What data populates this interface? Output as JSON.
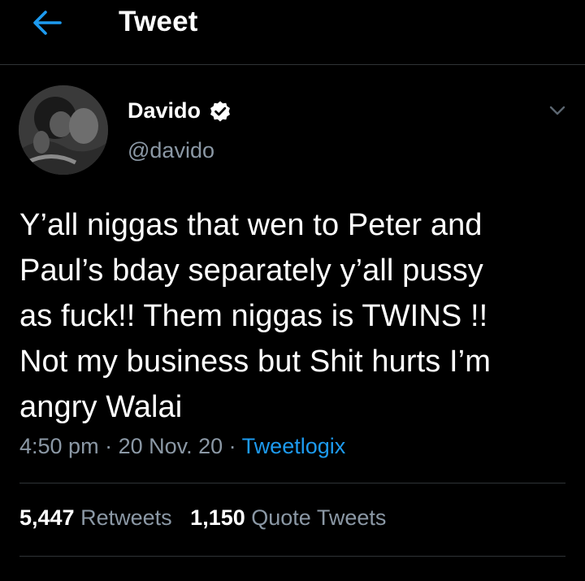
{
  "header": {
    "title": "Tweet",
    "back_icon": "arrow-left-icon",
    "accent_color": "#1d9bf0"
  },
  "tweet": {
    "author": {
      "display_name": "Davido",
      "handle": "@davido",
      "verified": true,
      "verified_icon": "verified-badge-icon"
    },
    "menu_icon": "chevron-down-icon",
    "text": "Y’all niggas that wen to Peter and\nPaul’s bday separately y’all pussy\nas fuck!! Them niggas  is TWINS !!\nNot my business but Shit hurts I’m\nangry Walai",
    "time": "4:50 pm",
    "date": "20 Nov. 20",
    "source": "Tweetlogix",
    "separator": " · "
  },
  "stats": {
    "retweets_count": "5,447",
    "retweets_label": "Retweets",
    "quote_tweets_count": "1,150",
    "quote_tweets_label": "Quote Tweets"
  },
  "colors": {
    "background": "#000000",
    "text_primary": "#ffffff",
    "text_secondary": "#8b98a5",
    "divider": "#2f3336",
    "link": "#1d9bf0"
  }
}
